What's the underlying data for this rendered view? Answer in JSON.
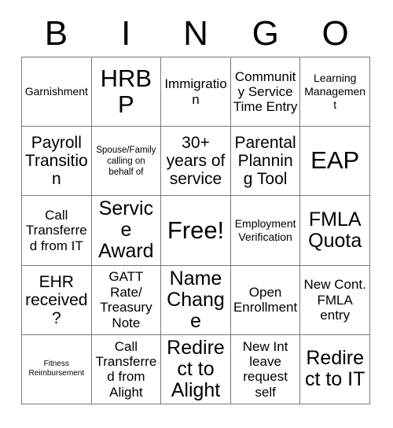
{
  "card": {
    "title": "BINGO Card",
    "free_space_label": "Free!",
    "grid_size": "5x5"
  },
  "header": {
    "letters": [
      {
        "label": "B"
      },
      {
        "label": "I"
      },
      {
        "label": "N"
      },
      {
        "label": "G"
      },
      {
        "label": "O"
      }
    ]
  },
  "colors": {
    "background": "#ffffff",
    "text": "#000000",
    "grid_line": "#7a7a7a"
  },
  "grid": {
    "rows": [
      {
        "cells": [
          {
            "label": "Garnishment",
            "size": "sm",
            "free": false
          },
          {
            "label": "HRBP",
            "size": "xxl",
            "free": false
          },
          {
            "label": "Immigration",
            "size": "md",
            "free": false
          },
          {
            "label": "Community Service Time Entry",
            "size": "md",
            "free": false
          },
          {
            "label": "Learning Management",
            "size": "sm",
            "free": false
          }
        ]
      },
      {
        "cells": [
          {
            "label": "Payroll Transition",
            "size": "lg",
            "free": false
          },
          {
            "label": "Spouse/Family calling on behalf of",
            "size": "xs",
            "free": false
          },
          {
            "label": "30+ years of service",
            "size": "lg",
            "free": false
          },
          {
            "label": "Parental Planning Tool",
            "size": "lg",
            "free": false
          },
          {
            "label": "EAP",
            "size": "xxl",
            "free": false
          }
        ]
      },
      {
        "cells": [
          {
            "label": "Call Transferred from IT",
            "size": "md",
            "free": false
          },
          {
            "label": "Service Award",
            "size": "xl",
            "free": false
          },
          {
            "label": "Free!",
            "size": "xxl",
            "free": true
          },
          {
            "label": "Employment Verification",
            "size": "sm",
            "free": false
          },
          {
            "label": "FMLA Quota",
            "size": "xl",
            "free": false
          }
        ]
      },
      {
        "cells": [
          {
            "label": "EHR received?",
            "size": "lg",
            "free": false
          },
          {
            "label": "GATT Rate/ Treasury Note",
            "size": "md",
            "free": false
          },
          {
            "label": "Name Change",
            "size": "xl",
            "free": false
          },
          {
            "label": "Open Enrollment",
            "size": "md",
            "free": false
          },
          {
            "label": "New Cont. FMLA entry",
            "size": "md",
            "free": false
          }
        ]
      },
      {
        "cells": [
          {
            "label": "Fitness Reimbursement",
            "size": "xxs",
            "free": false
          },
          {
            "label": "Call Transferred from Alight",
            "size": "md",
            "free": false
          },
          {
            "label": "Redirect to Alight",
            "size": "xl",
            "free": false
          },
          {
            "label": "New Int leave request self",
            "size": "md",
            "free": false
          },
          {
            "label": "Redirect to IT",
            "size": "xl",
            "free": false
          }
        ]
      }
    ]
  }
}
